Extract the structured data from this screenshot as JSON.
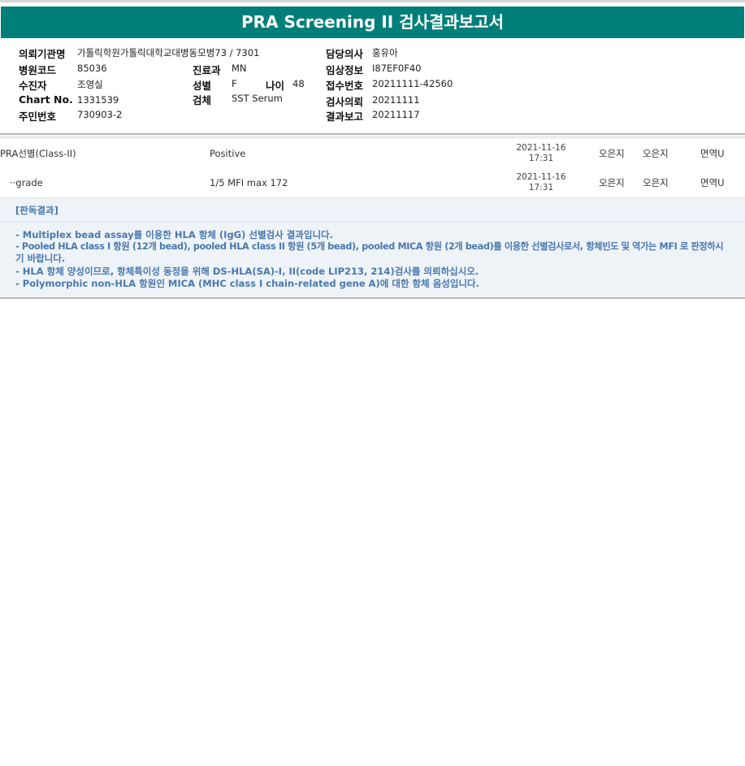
{
  "title": "PRA Screening II 검사결과보고서",
  "info": {
    "hospital_label": "의뢰기관명",
    "hospital_value": "가톨릭학원가톨릭대학교대병동모병73 / 7301",
    "doctor_label": "담당의사",
    "doctor_value": "홍유아",
    "code_label": "병원코드",
    "code_value": "85036",
    "dept_label": "진료과",
    "dept_value": "MN",
    "clinical_label": "임상정보",
    "clinical_value": "I87EF0F40",
    "patient_label": "수진자",
    "patient_value": "조영실",
    "sex_label": "성별",
    "sex_value": "F",
    "age_label": "나이",
    "age_value": "48",
    "receipt_label": "접수번호",
    "receipt_value": "20211111-42560",
    "chart_label": "Chart No.",
    "chart_value": "1331539",
    "specimen_label": "검체",
    "specimen_value": "SST Serum",
    "request_label": "검사의뢰",
    "request_value": "20211111",
    "id_label": "주민번호",
    "id_value": "730903-2",
    "report_label": "결과보고",
    "report_value": "20211117"
  },
  "results": [
    {
      "test": "PRA선별(Class-II)",
      "result": "Positive",
      "date": "2021-11-16",
      "time": "17:31",
      "tech1": "오은지",
      "tech2": "오은지",
      "dept": "면역U"
    },
    {
      "test": "··grade",
      "result": "1/5 MFI max 172",
      "date": "2021-11-16",
      "time": "17:31",
      "tech1": "오은지",
      "tech2": "오은지",
      "dept": "면역U"
    }
  ],
  "interpretation": {
    "title": "[판독결과]",
    "lines": [
      "- Multiplex bead assay를 이용한 HLA 항체 (IgG) 선별검사 결과입니다.",
      "- Pooled HLA class I 항원 (12개 bead), pooled HLA class II 항원 (5개 bead), pooled MICA 항원 (2개 bead)를 이용한 선별검사로서, 항체빈도 및 역가는 MFI 로 판정하시",
      "기 바랍니다.",
      "- HLA 항체 양성이므로, 항체특이성 동정을 위해 DS-HLA(SA)-I, II(code LIP213, 214)검사를 의뢰하십시오.",
      "- Polymorphic non-HLA 항원인 MICA (MHC class I chain-related gene A)에 대한 항체 음성입니다."
    ]
  }
}
